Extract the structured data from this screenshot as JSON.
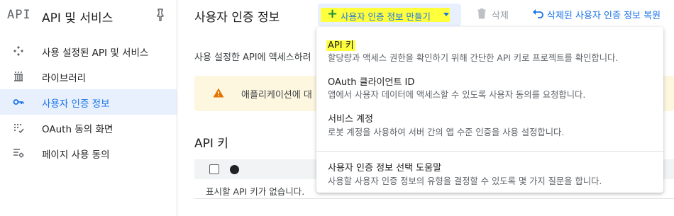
{
  "sidebar": {
    "logo_text": "API",
    "title": "API 및 서비스",
    "items": [
      {
        "label": "사용 설정된 API 및 서비스",
        "icon": "api-diamond-icon",
        "active": false
      },
      {
        "label": "라이브러리",
        "icon": "library-icon",
        "active": false
      },
      {
        "label": "사용자 인증 정보",
        "icon": "key-icon",
        "active": true
      },
      {
        "label": "OAuth 동의 화면",
        "icon": "consent-dots-icon",
        "active": false
      },
      {
        "label": "페이지 사용 동의",
        "icon": "settings-list-icon",
        "active": false
      }
    ]
  },
  "header": {
    "page_title": "사용자 인증 정보",
    "create_button": "사용자 인증 정보 만들기",
    "delete_button": "삭제",
    "restore_button": "삭제된 사용자 인증 정보 복원"
  },
  "main": {
    "description": "사용 설정한 API에 액세스하려",
    "warning_text": "애플리케이션에 대",
    "section_title": "API 키",
    "empty_row": "표시할 API 키가 없습니다."
  },
  "menu": {
    "items": [
      {
        "title": "API 키",
        "subtitle": "할당량과 액세스 권한을 확인하기 위해 간단한 API 키로 프로젝트를 확인합니다."
      },
      {
        "title": "OAuth 클라이언트 ID",
        "subtitle": "앱에서 사용자 데이터에 액세스할 수 있도록 사용자 동의를 요청합니다."
      },
      {
        "title": "서비스 계정",
        "subtitle": "로봇 계정을 사용하여 서버 간의 앱 수준 인증을 사용 설정합니다."
      },
      {
        "title": "사용자 인증 정보 선택 도움말",
        "subtitle": "사용할 사용자 인증 정보의 유형을 결정할 수 있도록 몇 가지 질문을 합니다."
      }
    ]
  },
  "colors": {
    "accent": "#1a73e8",
    "active_bg": "#e8f0fe",
    "highlight": "#ffff3b",
    "warning_bg": "#fef7e0",
    "warning_icon": "#e37400",
    "plus_green": "#1e8e3e"
  }
}
